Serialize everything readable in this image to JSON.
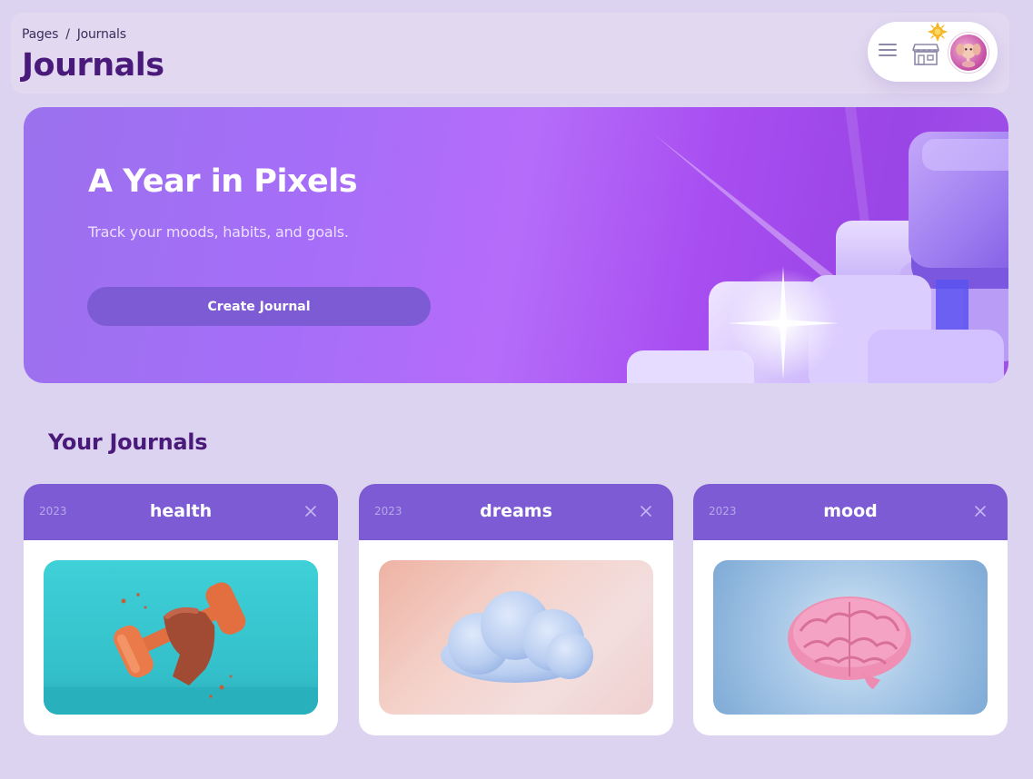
{
  "header": {
    "breadcrumb": {
      "root": "Pages",
      "separator": "/",
      "current": "Journals"
    },
    "title": "Journals",
    "icons": [
      "menu-icon",
      "store-icon",
      "sun-icon",
      "avatar"
    ]
  },
  "hero": {
    "title": "A Year in Pixels",
    "subtitle": "Track your moods, habits, and goals.",
    "button_label": "Create Journal"
  },
  "journals_section": {
    "title": "Your Journals",
    "items": [
      {
        "year": "2023",
        "title": "health",
        "image": "dumbbell-image"
      },
      {
        "year": "2023",
        "title": "dreams",
        "image": "cloud-image"
      },
      {
        "year": "2023",
        "title": "mood",
        "image": "brain-image"
      }
    ]
  },
  "colors": {
    "background": "#dcd3f0",
    "title": "#4a1a7a",
    "accent": "#7d5bd4",
    "hero_start": "#9b71ee",
    "hero_end": "#a050ea"
  }
}
